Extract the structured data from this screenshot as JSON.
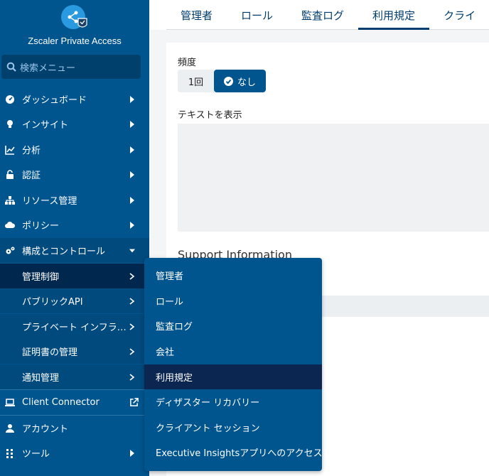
{
  "sidebar": {
    "brand_title": "Zscaler Private Access",
    "search_placeholder": "検索メニュー",
    "items": [
      {
        "label": "ダッシュボード"
      },
      {
        "label": "インサイト"
      },
      {
        "label": "分析"
      },
      {
        "label": "認証"
      },
      {
        "label": "リソース管理"
      },
      {
        "label": "ポリシー"
      },
      {
        "label": "構成とコントロール"
      }
    ],
    "subitems": [
      {
        "label": "管理制御"
      },
      {
        "label": "パブリックAPI"
      },
      {
        "label": "プライベート インフラ…"
      },
      {
        "label": "証明書の管理"
      },
      {
        "label": "通知管理"
      }
    ],
    "bottom_items": [
      {
        "label": "Client Connector"
      },
      {
        "label": "アカウント"
      },
      {
        "label": "ツール"
      }
    ]
  },
  "tabs": [
    {
      "label": "管理者"
    },
    {
      "label": "ロール"
    },
    {
      "label": "監査ログ"
    },
    {
      "label": "利用規定"
    },
    {
      "label": "クライ"
    }
  ],
  "form": {
    "frequency_label": "頻度",
    "option_once": "1回",
    "option_none": "なし",
    "display_text_label": "テキストを表示",
    "support_heading": "Support Information"
  },
  "flyout": [
    {
      "label": "管理者"
    },
    {
      "label": "ロール"
    },
    {
      "label": "監査ログ"
    },
    {
      "label": "会社"
    },
    {
      "label": "利用規定"
    },
    {
      "label": "ディザスター リカバリー"
    },
    {
      "label": "クライアント セッション"
    },
    {
      "label": "Executive Insightsアプリへのアクセス"
    }
  ],
  "colors": {
    "sidebar": "#00558f",
    "active_item": "#00284f",
    "accent": "#003c6e"
  }
}
